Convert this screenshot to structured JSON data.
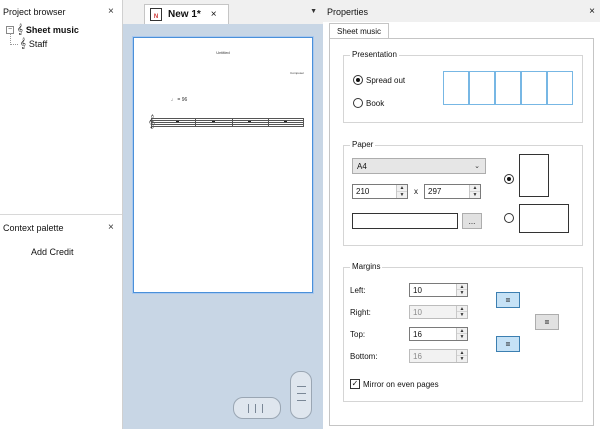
{
  "project_browser": {
    "title": "Project browser",
    "close": "×",
    "tree": {
      "expander": "−",
      "root_label": "Sheet music",
      "child_label": "Staff"
    }
  },
  "context_palette": {
    "title": "Context palette",
    "close": "×",
    "item": "Add Credit"
  },
  "document": {
    "tab_label": "New 1*",
    "tab_icon_text": "N",
    "tab_close": "×",
    "tab_menu": "▼",
    "page_title": "Untitled",
    "page_composer": "Composer",
    "tempo": "♩ = 96"
  },
  "properties": {
    "title": "Properties",
    "close": "×",
    "tab": "Sheet music",
    "presentation": {
      "title": "Presentation",
      "spread_out": "Spread out",
      "book": "Book",
      "selected": "spread_out"
    },
    "paper": {
      "title": "Paper",
      "size": "A4",
      "width": "210",
      "times": "x",
      "height": "297",
      "browse": "...",
      "orientation": "portrait"
    },
    "margins": {
      "title": "Margins",
      "left_label": "Left:",
      "left": "10",
      "right_label": "Right:",
      "right": "10",
      "top_label": "Top:",
      "top": "16",
      "bottom_label": "Bottom:",
      "bottom": "16",
      "link": "=",
      "mirror": "Mirror on even pages",
      "mirror_checked": true
    }
  }
}
